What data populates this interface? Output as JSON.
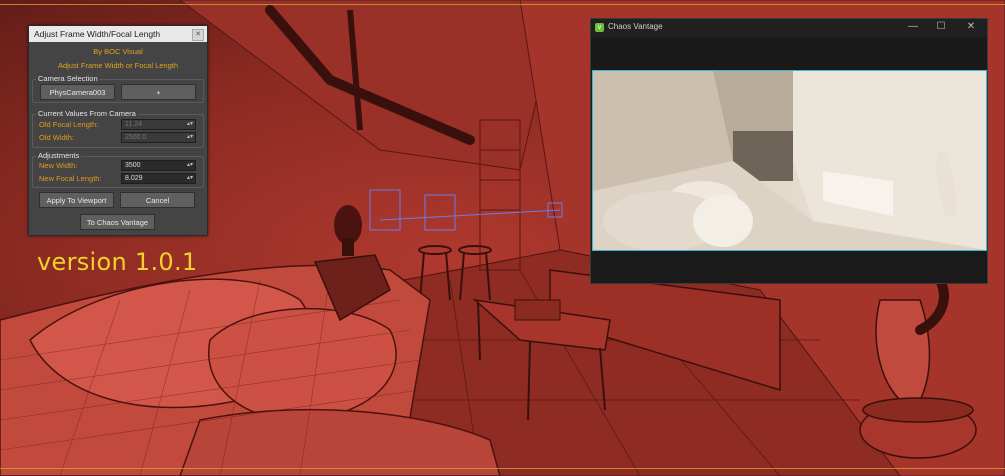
{
  "version_label": "version 1.0.1",
  "tool": {
    "title": "Adjust Frame Width/Focal Length",
    "credit_line1": "By BOC Visual",
    "credit_line2": "Adjust Frame Width or Focal Length",
    "camera_selection": {
      "title": "Camera Selection",
      "camera_button": "PhysCamera003",
      "add_button": "+"
    },
    "current_values": {
      "title": "Current Values From Camera",
      "old_focal_label": "Old Focal Length:",
      "old_focal_value": "11.24",
      "old_width_label": "Old Width:",
      "old_width_value": "2500.0"
    },
    "adjustments": {
      "title": "Adjustments",
      "new_width_label": "New Width:",
      "new_width_value": "3500",
      "new_focal_label": "New Focal Length:",
      "new_focal_value": "8.029"
    },
    "apply_button": "Apply To Viewport",
    "cancel_button": "Cancel",
    "vantage_button": "To Chaos Vantage"
  },
  "vantage": {
    "title": "Chaos Vantage",
    "minimize": "—",
    "maximize": "☐",
    "close": "✕"
  }
}
